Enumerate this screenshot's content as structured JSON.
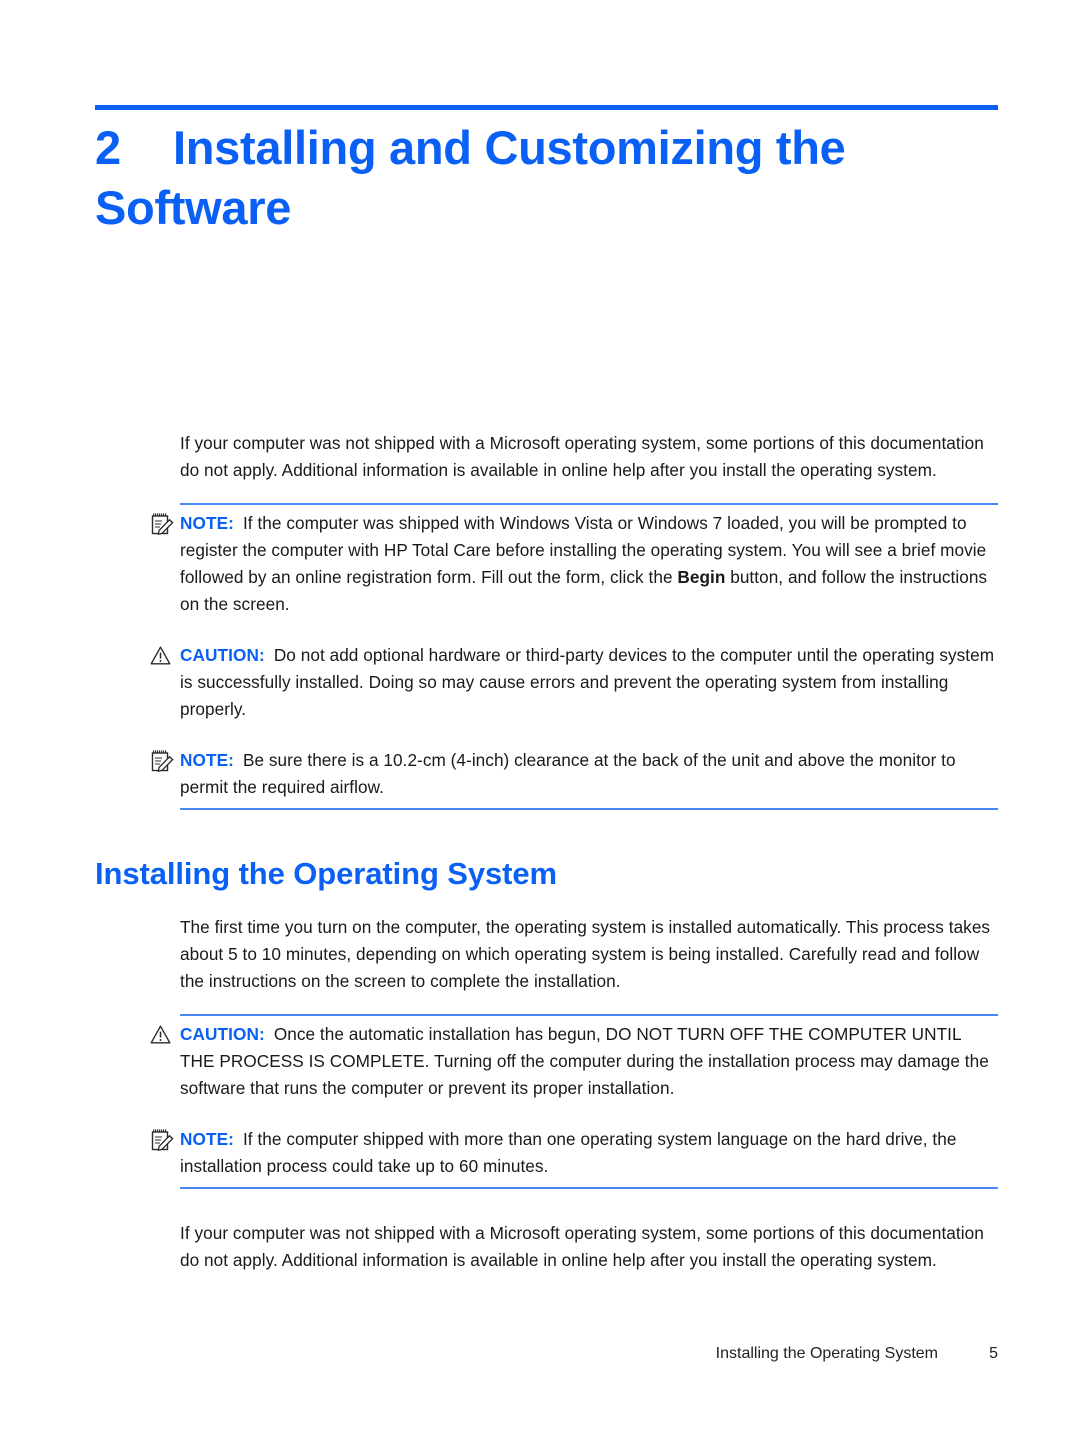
{
  "colors": {
    "brand_blue": "#0a60f5",
    "rule_blue": "#4a86f7",
    "body_text": "#1a1a1a"
  },
  "chapter": {
    "number": "2",
    "title": "Installing and Customizing the Software"
  },
  "content": {
    "intro_paragraph": "If your computer was not shipped with a Microsoft operating system, some portions of this documentation do not apply. Additional information is available in online help after you install the operating system.",
    "note_1": {
      "icon": "note-icon",
      "label": "NOTE:",
      "text_before_bold": "If the computer was shipped with Windows Vista or Windows 7 loaded, you will be prompted to register the computer with HP Total Care before installing the operating system. You will see a brief movie followed by an online registration form. Fill out the form, click the ",
      "bold_word": "Begin",
      "text_after_bold": " button, and follow the instructions on the screen."
    },
    "caution_1": {
      "icon": "caution-icon",
      "label": "CAUTION:",
      "text": "Do not add optional hardware or third-party devices to the computer until the operating system is successfully installed. Doing so may cause errors and prevent the operating system from installing properly."
    },
    "note_2": {
      "icon": "note-icon",
      "label": "NOTE:",
      "text": "Be sure there is a 10.2-cm (4-inch) clearance at the back of the unit and above the monitor to permit the required airflow."
    },
    "section_heading": "Installing the Operating System",
    "section_paragraph": "The first time you turn on the computer, the operating system is installed automatically. This process takes about 5 to 10 minutes, depending on which operating system is being installed. Carefully read and follow the instructions on the screen to complete the installation.",
    "caution_2": {
      "icon": "caution-icon",
      "label": "CAUTION:",
      "text": "Once the automatic installation has begun, DO NOT TURN OFF THE COMPUTER UNTIL THE PROCESS IS COMPLETE. Turning off the computer during the installation process may damage the software that runs the computer or prevent its proper installation."
    },
    "note_3": {
      "icon": "note-icon",
      "label": "NOTE:",
      "text": "If the computer shipped with more than one operating system language on the hard drive, the installation process could take up to 60 minutes."
    },
    "closing_paragraph": "If your computer was not shipped with a Microsoft operating system, some portions of this documentation do not apply. Additional information is available in online help after you install the operating system."
  },
  "footer": {
    "title": "Installing the Operating System",
    "page_number": "5"
  }
}
